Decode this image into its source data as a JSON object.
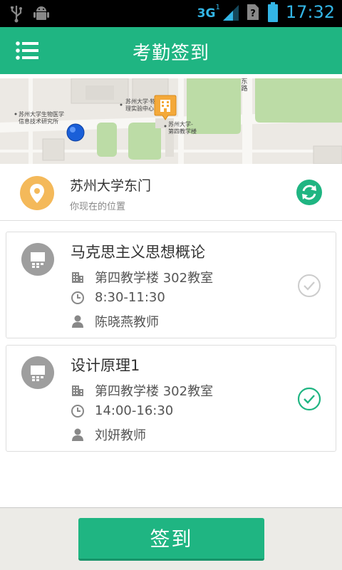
{
  "status_bar": {
    "network": "3G",
    "network_sup": "1",
    "time": "17:32"
  },
  "header": {
    "title": "考勤签到",
    "menu_icon": "menu-icon"
  },
  "map": {
    "labels": {
      "road": "东路",
      "label_a_1": "苏州大学·物",
      "label_a_2": "理实验中心",
      "label_b_1": "苏州大学生物医学",
      "label_b_2": "信息技术研究所",
      "label_c_1": "苏州大学-",
      "label_c_2": "第四教学楼"
    }
  },
  "location": {
    "name": "苏州大学东门",
    "subtitle": "你现在的位置"
  },
  "courses": [
    {
      "title": "马克思主义思想概论",
      "location": "第四教学楼 302教室",
      "time": "8:30-11:30",
      "teacher": "陈晓燕教师",
      "checked": false
    },
    {
      "title": "设计原理1",
      "location": "第四教学楼 302教室",
      "time": "14:00-16:30",
      "teacher": "刘妍教师",
      "checked": true
    }
  ],
  "footer": {
    "signin_label": "签到"
  },
  "colors": {
    "accent": "#1fb582",
    "pin": "#f4b95a",
    "check_inactive": "#cccccc"
  }
}
